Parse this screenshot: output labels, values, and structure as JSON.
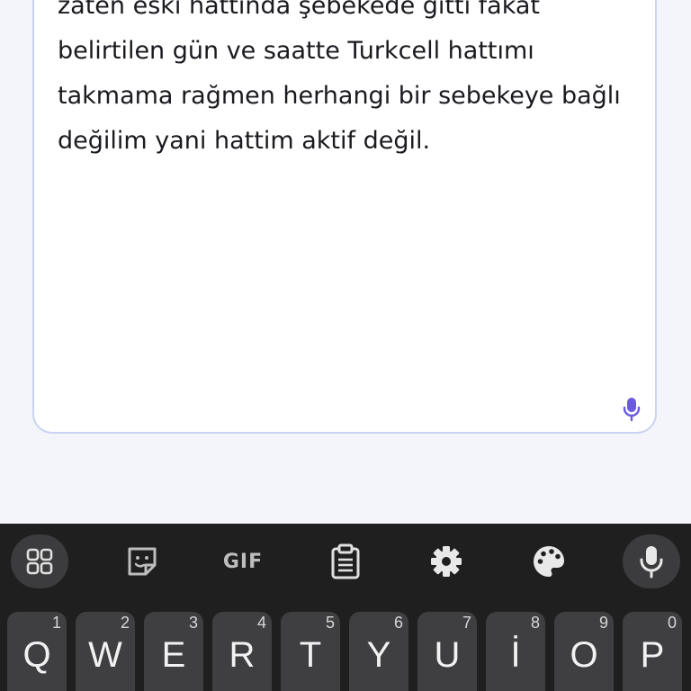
{
  "message": {
    "text": "zaten eski hattında şebekede gitti fakat belirtilen gün ve saatte Turkcell hattımı takmama rağmen herhangi bir sebekeye bağlı değilim yani hattim aktif değil."
  },
  "input_mic": {
    "icon": "microphone-icon",
    "color": "#6a5ae0"
  },
  "keyboard": {
    "toolbar": {
      "apps_icon": "apps-grid-icon",
      "sticker_icon": "sticker-icon",
      "gif_label": "GIF",
      "clipboard_icon": "clipboard-icon",
      "settings_icon": "gear-icon",
      "theme_icon": "palette-icon",
      "voice_icon": "microphone-icon"
    },
    "row1": [
      {
        "label": "Q",
        "hint": "1"
      },
      {
        "label": "W",
        "hint": "2"
      },
      {
        "label": "E",
        "hint": "3"
      },
      {
        "label": "R",
        "hint": "4"
      },
      {
        "label": "T",
        "hint": "5"
      },
      {
        "label": "Y",
        "hint": "6"
      },
      {
        "label": "U",
        "hint": "7"
      },
      {
        "label": "İ",
        "hint": "8"
      },
      {
        "label": "O",
        "hint": "9"
      },
      {
        "label": "P",
        "hint": "0"
      }
    ]
  }
}
